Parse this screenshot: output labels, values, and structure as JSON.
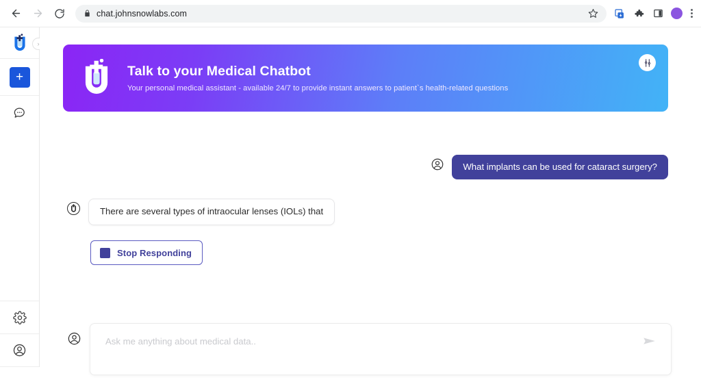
{
  "browser": {
    "url": "chat.johnsnowlabs.com",
    "back_label": "Back",
    "forward_label": "Forward",
    "reload_label": "Reload",
    "lock_icon": "lock-icon",
    "bookmark_icon": "star-icon",
    "install_icon": "install-app-icon",
    "extensions_icon": "puzzle-piece-icon",
    "side_panel_icon": "side-panel-icon",
    "profile_icon": "profile-avatar-icon",
    "menu_icon": "three-dot-menu-icon",
    "profile_color": "#8b55e0"
  },
  "sidebar": {
    "logo_name": "john-snow-labs-logo",
    "collapse_label": "›",
    "items": [
      {
        "name": "new-chat",
        "icon": "plus-icon",
        "label": "+"
      },
      {
        "name": "conversations",
        "icon": "chat-bubble-icon"
      }
    ],
    "bottom_items": [
      {
        "name": "settings",
        "icon": "gear-icon"
      },
      {
        "name": "account",
        "icon": "user-circle-icon"
      }
    ]
  },
  "hero": {
    "title": "Talk to your Medical Chatbot",
    "subtitle": "Your personal medical assistant - available 24/7 to provide instant answers to patient`s health-related questions",
    "logo_icon": "john-snow-labs-logo",
    "settings_icon": "tune-sliders-icon",
    "gradient_start": "#8b25f5",
    "gradient_end": "#42b3f7"
  },
  "conversation": {
    "user_message": {
      "text": "What implants can be used for cataract surgery?",
      "avatar_icon": "user-circle-icon",
      "bubble_color": "#41419b"
    },
    "bot_message": {
      "text": "There are several types of intraocular lenses (IOLs) that",
      "avatar_icon": "chatbot-logo-icon"
    },
    "stop_button": {
      "label": "Stop Responding",
      "icon": "stop-square-icon",
      "accent_color": "#41419b"
    }
  },
  "composer": {
    "placeholder": "Ask me anything about medical data..",
    "value": "",
    "avatar_icon": "user-circle-icon",
    "send_icon": "send-paper-plane-icon"
  }
}
